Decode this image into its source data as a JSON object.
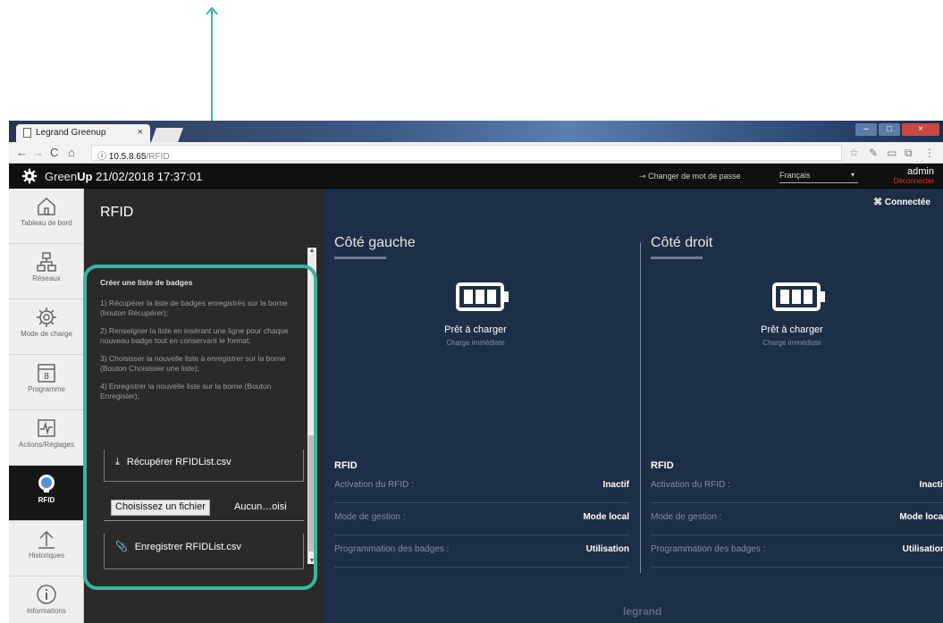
{
  "browser": {
    "tab_title": "Legrand Greenup",
    "url_host": "10.5.8.65",
    "url_path": "/RFID"
  },
  "header": {
    "brand_green": "Green",
    "brand_up": "Up",
    "datetime": "21/02/2018 17:37:01",
    "change_password": "Changer de mot de passe",
    "language": "Français",
    "user": "admin",
    "logout": "Déconnecter"
  },
  "nav": {
    "items": [
      {
        "label": "Tableau de bord",
        "icon": "home-icon"
      },
      {
        "label": "Réseaux",
        "icon": "network-icon"
      },
      {
        "label": "Mode de charge",
        "icon": "gear-icon"
      },
      {
        "label": "Programme",
        "icon": "calendar-icon",
        "day": "8"
      },
      {
        "label": "Actions/Réglages",
        "icon": "pulse-icon"
      },
      {
        "label": "RFID",
        "icon": "rfid-icon",
        "active": true
      },
      {
        "label": "Historiques",
        "icon": "upload-icon"
      },
      {
        "label": "Informations",
        "icon": "info-icon"
      }
    ]
  },
  "rfid_panel": {
    "title": "RFID",
    "heading": "Créer une liste de badges",
    "steps": [
      "1) Récupérer la liste de badges enregistrés sur la borne (bouton Récupérer);",
      "2) Renseigner la liste en insérant une ligne pour chaque nouveau badge tout en conservant le format;",
      "3) Choisisser la nouvelle liste à enregistrer sur la borne (Bouton Choisisser une liste);",
      "4) Enregistrer la nouvelle liste sur la borne (Bouton Enregister);"
    ],
    "download_label": "Récupérer RFIDList.csv",
    "file_button": "Choisissez un fichier",
    "file_status": "Aucun…oisi",
    "save_label": "Enregistrer RFIDList.csv"
  },
  "main": {
    "status": "Connectée",
    "left": {
      "title": "Côté gauche",
      "state": "Prêt à charger",
      "mode": "Charge immédiate",
      "rfid_title": "RFID",
      "rows": [
        {
          "k": "Activation du RFID :",
          "v": "Inactif"
        },
        {
          "k": "Mode de gestion :",
          "v": "Mode local"
        },
        {
          "k": "Programmation des badges :",
          "v": "Utilisation"
        }
      ]
    },
    "right": {
      "title": "Côté droit",
      "state": "Prêt à charger",
      "mode": "Charge immédiate",
      "rfid_title": "RFID",
      "rows": [
        {
          "k": "Activation du RFID :",
          "v": "Inactif"
        },
        {
          "k": "Mode de gestion :",
          "v": "Mode local"
        },
        {
          "k": "Programmation des badges :",
          "v": "Utilisation"
        }
      ]
    },
    "footer_logo": "legrand"
  },
  "colors": {
    "annotation": "#3bb4a4",
    "main_bg": "#1d2e47",
    "logout": "#e0312a"
  }
}
